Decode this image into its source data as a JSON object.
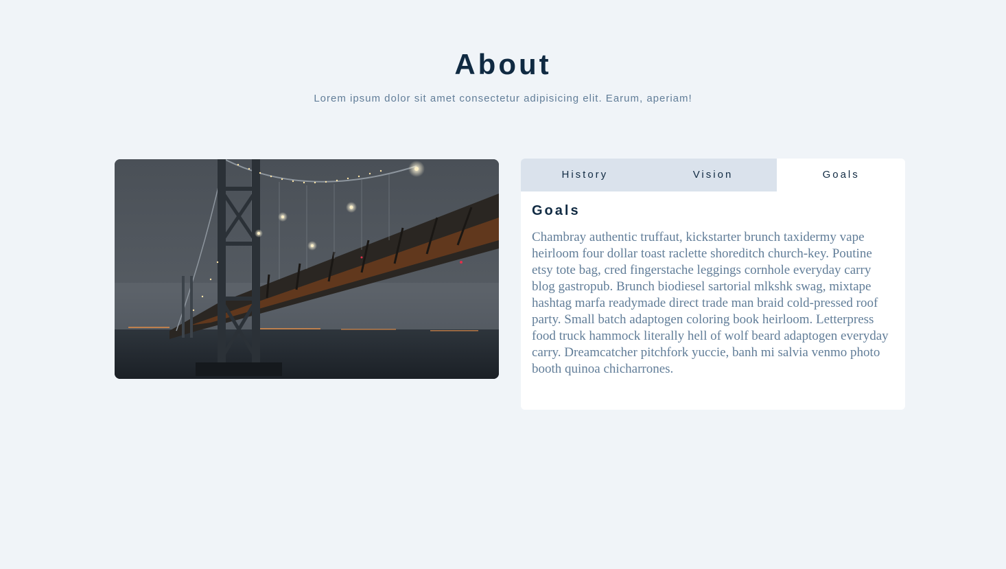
{
  "header": {
    "title": "About",
    "subtitle": "Lorem ipsum dolor sit amet consectetur adipisicing elit. Earum, aperiam!"
  },
  "image": {
    "subject": "bridge-at-night-photo"
  },
  "tabs": [
    {
      "label": "History",
      "active": false
    },
    {
      "label": "Vision",
      "active": false
    },
    {
      "label": "Goals",
      "active": true
    }
  ],
  "content": {
    "heading": "Goals",
    "text": "Chambray authentic truffaut, kickstarter brunch taxidermy vape heirloom four dollar toast raclette shoreditch church-key. Poutine etsy tote bag, cred fingerstache leggings cornhole everyday carry blog gastropub. Brunch biodiesel sartorial mlkshk swag, mixtape hashtag marfa readymade direct trade man braid cold-pressed roof party. Small batch adaptogen coloring book heirloom. Letterpress food truck hammock literally hell of wolf beard adaptogen everyday carry. Dreamcatcher pitchfork yuccie, banh mi salvia venmo photo booth quinoa chicharrones."
  },
  "colors": {
    "background": "#f0f4f8",
    "heading": "#102a42",
    "body_text": "#617d98",
    "tab_inactive": "#dae2ec",
    "tab_active": "#ffffff"
  }
}
